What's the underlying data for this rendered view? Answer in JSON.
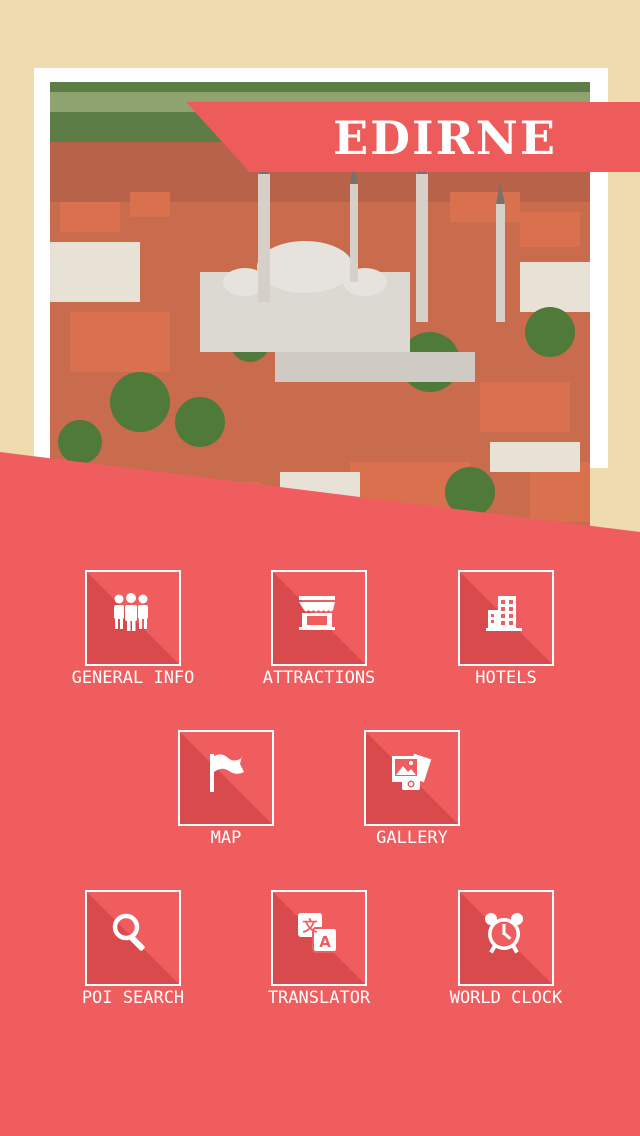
{
  "header": {
    "title": "EDIRNE"
  },
  "photo": {
    "icon": "city-mosque-photo"
  },
  "menu": {
    "items": [
      {
        "label": "GENERAL INFO",
        "icon": "people-icon"
      },
      {
        "label": "ATTRACTIONS",
        "icon": "storefront-icon"
      },
      {
        "label": "HOTELS",
        "icon": "building-icon"
      },
      {
        "label": "MAP",
        "icon": "flag-icon"
      },
      {
        "label": "GALLERY",
        "icon": "photos-icon"
      },
      {
        "label": "POI SEARCH",
        "icon": "search-icon"
      },
      {
        "label": "TRANSLATOR",
        "icon": "translate-icon"
      },
      {
        "label": "WORLD CLOCK",
        "icon": "alarm-clock-icon"
      }
    ]
  },
  "colors": {
    "background": "#EEDBAE",
    "accent": "#EF5D5E",
    "tile_shadow": "#D94A4C",
    "text": "#FFFFFF"
  }
}
